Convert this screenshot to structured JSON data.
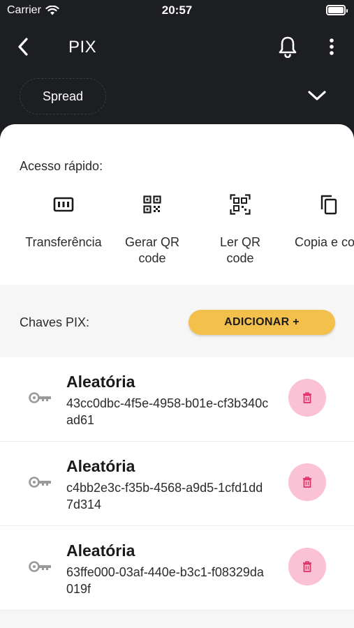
{
  "status_bar": {
    "carrier": "Carrier",
    "time": "20:57"
  },
  "header": {
    "title": "PIX",
    "account": "Spread"
  },
  "quick_access": {
    "label": "Acesso rápido:",
    "items": [
      {
        "label": "Transferência",
        "icon": "transfer-icon"
      },
      {
        "label": "Gerar QR\ncode",
        "icon": "generate-qr-icon"
      },
      {
        "label": "Ler QR\ncode",
        "icon": "scan-qr-icon"
      },
      {
        "label": "Copia e co",
        "icon": "copy-icon"
      }
    ]
  },
  "keys": {
    "label": "Chaves PIX:",
    "add_label": "ADICIONAR +",
    "items": [
      {
        "type": "Aleatória",
        "value": "43cc0dbc-4f5e-4958-b01e-cf3b340cad61"
      },
      {
        "type": "Aleatória",
        "value": "c4bb2e3c-f35b-4568-a9d5-1cfd1dd7d314"
      },
      {
        "type": "Aleatória",
        "value": "63ffe000-03af-440e-b3c1-f08329da019f"
      }
    ]
  },
  "colors": {
    "background": "#1d1e22",
    "accent": "#f4c04c",
    "delete_bg": "#fac2d4",
    "delete_icon": "#e0336a"
  }
}
